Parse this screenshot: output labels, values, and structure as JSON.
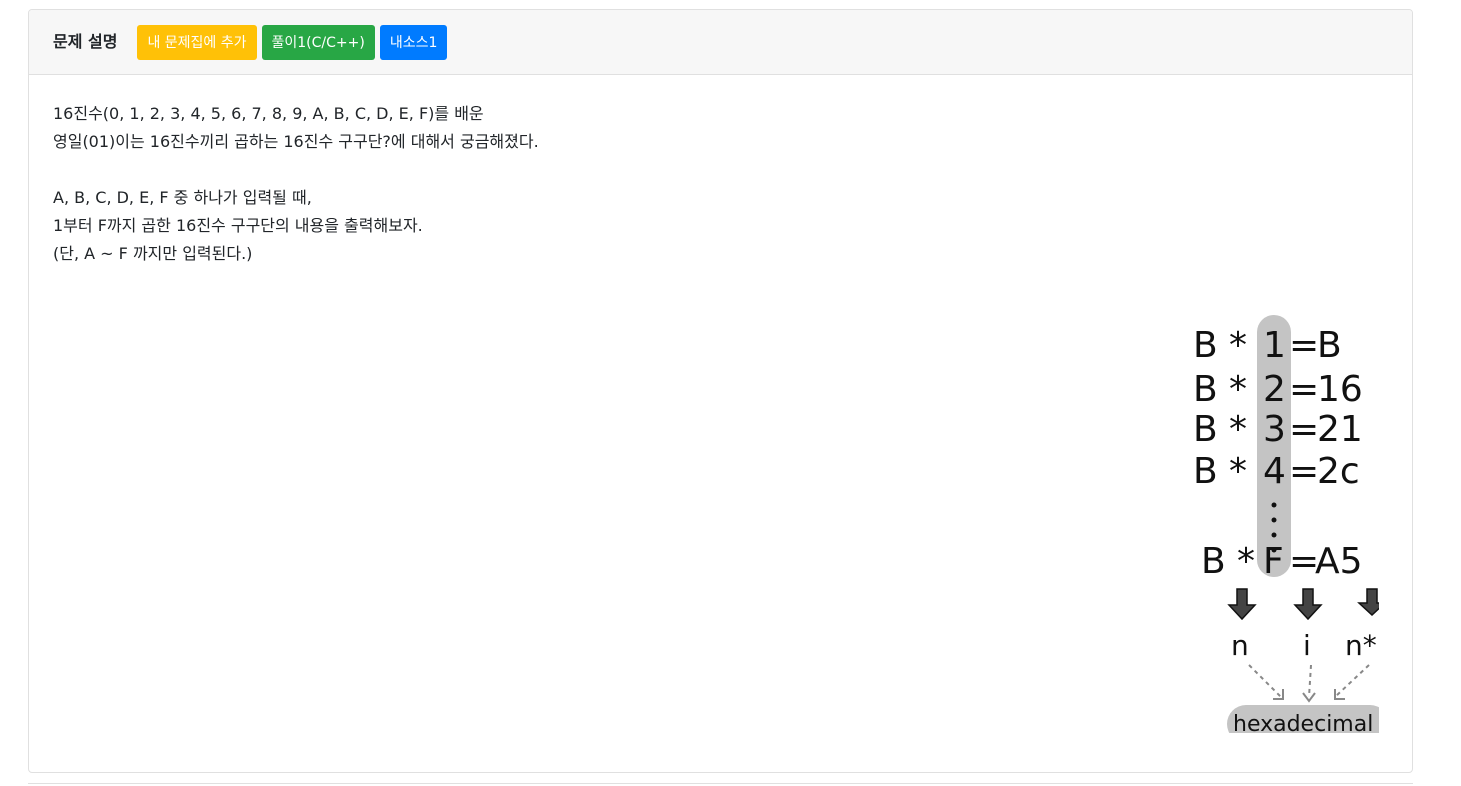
{
  "header": {
    "title": "문제 설명",
    "buttons": {
      "add_to_set": "내 문제집에 추가",
      "solution": "풀이1(C/C++)",
      "my_source": "내소스1"
    }
  },
  "description": {
    "lines": [
      "16진수(0, 1, 2, 3, 4, 5, 6, 7, 8, 9, A, B, C, D, E, F)를 배운",
      "영일(01)이는 16진수끼리 곱하는 16진수 구구단?에 대해서 궁금해졌다.",
      "",
      "A, B, C, D, E, F 중 하나가 입력될 때,",
      "1부터 F까지 곱한 16진수 구구단의 내용을 출력해보자.",
      "(단, A ~ F 까지만 입력된다.)"
    ]
  },
  "illustration": {
    "rows": [
      {
        "n": "B",
        "op": "*",
        "i": "1",
        "eq": "=",
        "result": "B"
      },
      {
        "n": "B",
        "op": "*",
        "i": "2",
        "eq": "=",
        "result": "16"
      },
      {
        "n": "B",
        "op": "*",
        "i": "3",
        "eq": "=",
        "result": "21"
      },
      {
        "n": "B",
        "op": "*",
        "i": "4",
        "eq": "=",
        "result": "2c"
      },
      {
        "n": "B",
        "op": "*",
        "i": "F",
        "eq": "=",
        "result": "A5"
      }
    ],
    "labels": {
      "n": "n",
      "i": "i",
      "product": "n*i",
      "output": "hexadecimal"
    },
    "colors": {
      "highlight": "#c4c4c4",
      "ink": "#111111",
      "arrow": "#444444",
      "dashed": "#888888"
    }
  }
}
